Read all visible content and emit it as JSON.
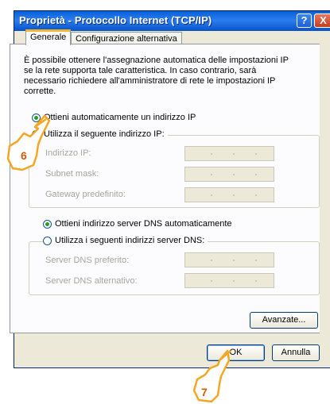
{
  "window": {
    "title": "Proprietà - Protocollo Internet (TCP/IP)",
    "help_label": "?",
    "close_label": "X"
  },
  "tabs": [
    {
      "label": "Generale",
      "active": true
    },
    {
      "label": "Configurazione alternativa",
      "active": false
    }
  ],
  "description": "È possibile ottenere l'assegnazione automatica delle impostazioni IP se la rete supporta tale caratteristica. In caso contrario, sarà necessario richiedere all'amministratore di rete le impostazioni IP corrette.",
  "ip_options": {
    "auto_label": "Ottieni automaticamente un indirizzo IP",
    "auto_checked": true,
    "manual_label": "Utilizza il seguente indirizzo IP:",
    "manual_checked": false,
    "fields": [
      {
        "label": "Indirizzo IP:",
        "value": "   .   .   ."
      },
      {
        "label": "Subnet mask:",
        "value": "   .   .   ."
      },
      {
        "label": "Gateway predefinito:",
        "value": "   .   .   ."
      }
    ]
  },
  "dns_options": {
    "auto_label": "Ottieni indirizzo server DNS automaticamente",
    "auto_checked": true,
    "manual_label": "Utilizza i seguenti indirizzi server DNS:",
    "manual_checked": false,
    "fields": [
      {
        "label": "Server DNS preferito:",
        "value": "   .   .   ."
      },
      {
        "label": "Server DNS alternativo:",
        "value": "   .   .   ."
      }
    ]
  },
  "buttons": {
    "advanced": "Avanzate...",
    "ok": "OK",
    "cancel": "Annulla"
  },
  "callouts": [
    {
      "number": "6"
    },
    {
      "number": "7"
    }
  ],
  "colors": {
    "titlebar": "#0a5fd8",
    "callout": "#f5a623",
    "radio_dot": "#21a121"
  }
}
